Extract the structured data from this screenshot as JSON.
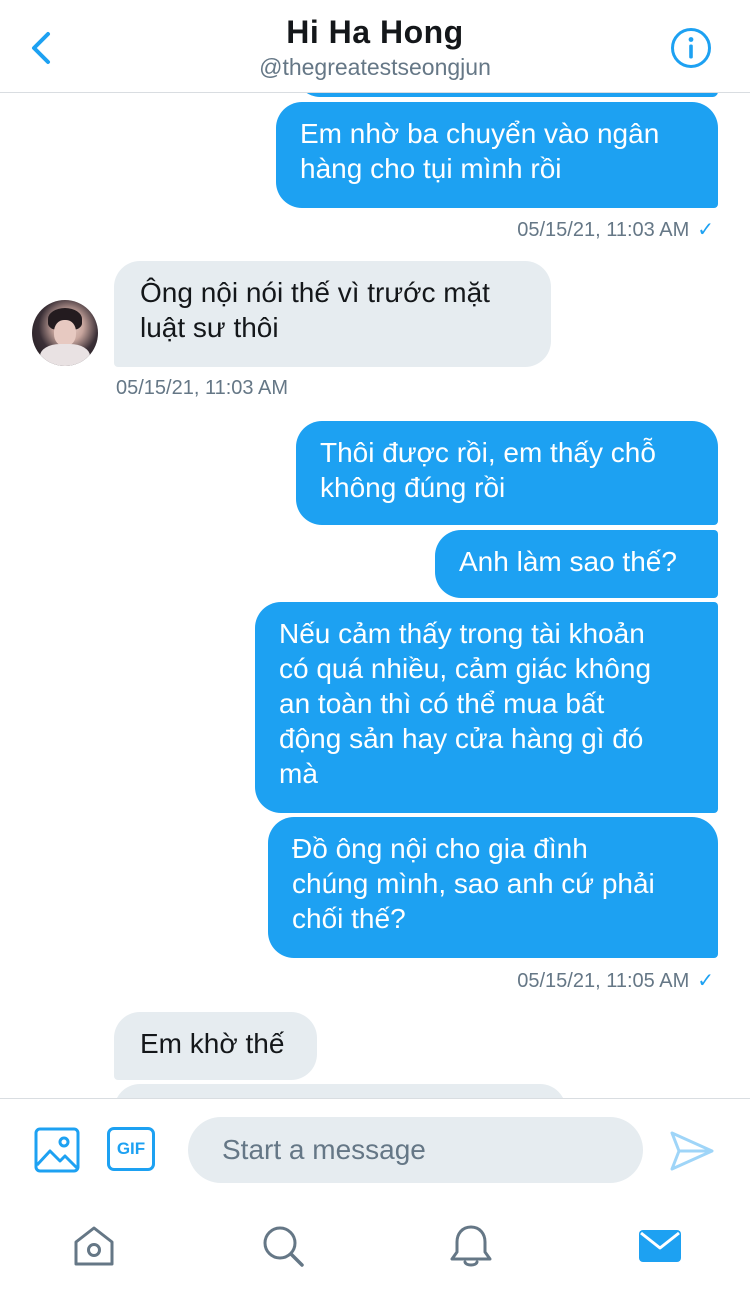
{
  "header": {
    "title": "Hi Ha Hong",
    "handle": "@thegreatestseongjun"
  },
  "conversation": {
    "messages": [
      {
        "direction": "out",
        "text": "Em nhờ ba chuyển vào ngân\nhàng cho tụi mình rồi"
      },
      {
        "direction": "in",
        "text": "Ông nội nói thế vì trước mặt\nluật sư thôi"
      },
      {
        "direction": "out",
        "text": "Thôi được rồi, em thấy chỗ\nkhông đúng rồi"
      },
      {
        "direction": "out",
        "text": "Anh làm sao thế?"
      },
      {
        "direction": "out",
        "text": "Nếu cảm thấy trong tài khoản\ncó quá nhiều, cảm giác không\nan toàn thì có thể mua bất\nđộng sản hay cửa hàng gì đó\nmà"
      },
      {
        "direction": "out",
        "text": "Đồ ông nội cho gia đình\nchúng mình, sao anh cứ phải\nchối thế?"
      },
      {
        "direction": "in",
        "text": "Em khờ thế"
      }
    ],
    "timestamps": [
      "05/15/21, 11:03 AM",
      "05/15/21, 11:03 AM",
      "05/15/21, 11:05 AM"
    ],
    "read_check": "✓"
  },
  "composer": {
    "gif_label": "GIF",
    "placeholder": "Start a message"
  },
  "tabbar": {
    "items": [
      "home-icon",
      "search-icon",
      "notifications-icon",
      "messages-icon"
    ],
    "active": "messages-icon"
  },
  "colors": {
    "accent": "#1da1f2",
    "incoming_bubble": "#e6ecf0",
    "secondary_text": "#657786"
  }
}
